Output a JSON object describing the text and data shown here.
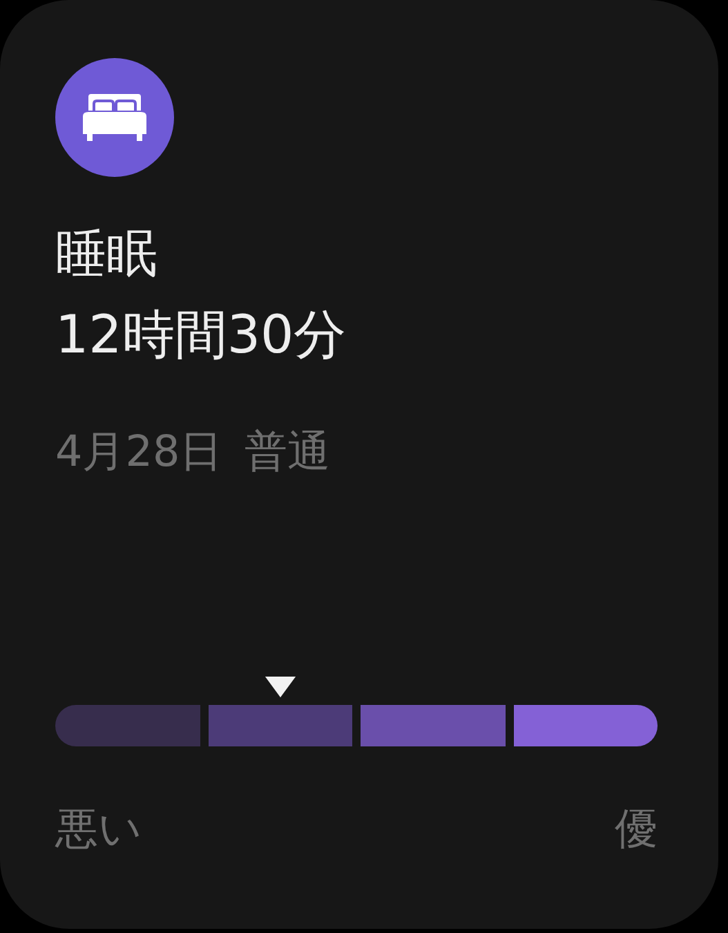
{
  "title": "睡眠",
  "duration": "12時間30分",
  "date": "4月28日",
  "rating": "普通",
  "scale": {
    "segments": [
      {
        "color": "#372d4d",
        "selected": false
      },
      {
        "color": "#4c3b78",
        "selected": true
      },
      {
        "color": "#6a4fab",
        "selected": false
      },
      {
        "color": "#8461d6",
        "selected": false
      }
    ],
    "low_label": "悪い",
    "high_label": "優"
  }
}
